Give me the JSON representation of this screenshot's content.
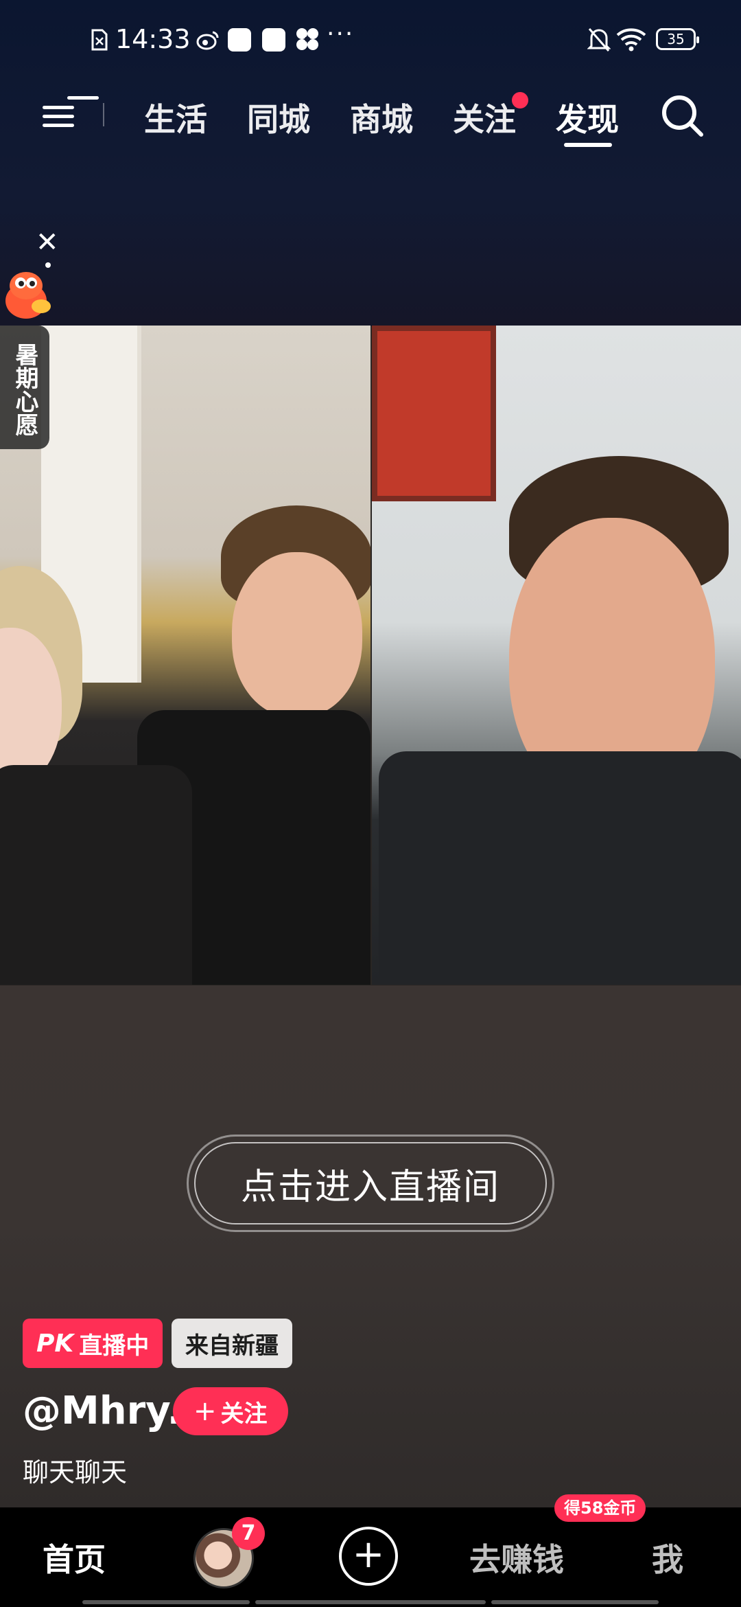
{
  "status_bar": {
    "time": "14:33",
    "dots": "···",
    "battery": "35"
  },
  "top_nav": {
    "tabs": [
      {
        "label": "生活"
      },
      {
        "label": "同城"
      },
      {
        "label": "商城"
      },
      {
        "label": "关注"
      },
      {
        "label": "发现"
      }
    ],
    "active_tab": "发现"
  },
  "promo": {
    "label": "暑期心愿"
  },
  "live": {
    "enter_label": "点击进入直播间",
    "pk_badge": "PK",
    "status_label": "直播中",
    "origin_label": "来自新疆",
    "username": "@Mhry.",
    "follow_label": "关注",
    "description": "聊天聊天"
  },
  "bottom_nav": {
    "home_label": "首页",
    "friends_badge": "7",
    "earn_label": "去赚钱",
    "coin_badge": "得58金币",
    "me_label": "我"
  },
  "colors": {
    "accent": "#ff2f55",
    "top_background": "#0b1630",
    "bottom_bar": "#000000"
  }
}
